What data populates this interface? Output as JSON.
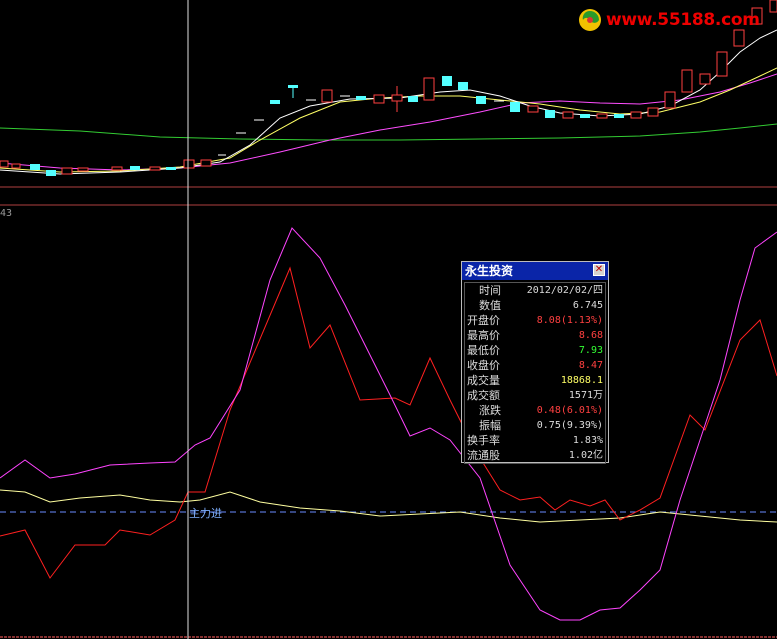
{
  "watermark": {
    "text": "www.55188.com",
    "logo_icon": "swirl-logo-icon"
  },
  "indicator_panel": {
    "scale_label": "43"
  },
  "marker": {
    "label": "主力进"
  },
  "colors": {
    "background": "#000000",
    "up_candle": "#ff4040",
    "down_candle": "#54ffff",
    "ma_short": "#ffffff",
    "ma_mid": "#ffff66",
    "ma_long": "#ff4dff",
    "ma_longest": "#33cc33",
    "indicator_red": "#ff2020",
    "indicator_magenta": "#ff44ff",
    "indicator_yellow": "#ffffa0",
    "baseline_dash": "#6a8cff",
    "title_bar": "#0a25a8"
  },
  "info_window": {
    "title": "永生投资",
    "close_icon": "close-x-icon",
    "rows": [
      {
        "label": "时间",
        "value": "2012/02/02/四",
        "color": "#dcdcdc",
        "indent": true
      },
      {
        "label": "数值",
        "value": "6.745",
        "color": "#dcdcdc",
        "indent": true
      },
      {
        "label": "开盘价",
        "value": "8.08(1.13%)",
        "color": "#ff4040",
        "indent": false
      },
      {
        "label": "最高价",
        "value": "8.68",
        "color": "#ff4040",
        "indent": false
      },
      {
        "label": "最低价",
        "value": "7.93",
        "color": "#33ff33",
        "indent": false
      },
      {
        "label": "收盘价",
        "value": "8.47",
        "color": "#ff4040",
        "indent": false
      },
      {
        "label": "成交量",
        "value": "18868.1",
        "color": "#ffff66",
        "indent": false
      },
      {
        "label": "成交额",
        "value": "1571万",
        "color": "#dcdcdc",
        "indent": false
      },
      {
        "label": "涨跌",
        "value": "0.48(6.01%)",
        "color": "#ff4040",
        "indent": true
      },
      {
        "label": "振幅",
        "value": "0.75(9.39%)",
        "color": "#dcdcdc",
        "indent": true
      },
      {
        "label": "换手率",
        "value": "1.83%",
        "color": "#dcdcdc",
        "indent": false
      },
      {
        "label": "流通股",
        "value": "1.02亿",
        "color": "#dcdcdc",
        "indent": false
      }
    ]
  }
}
